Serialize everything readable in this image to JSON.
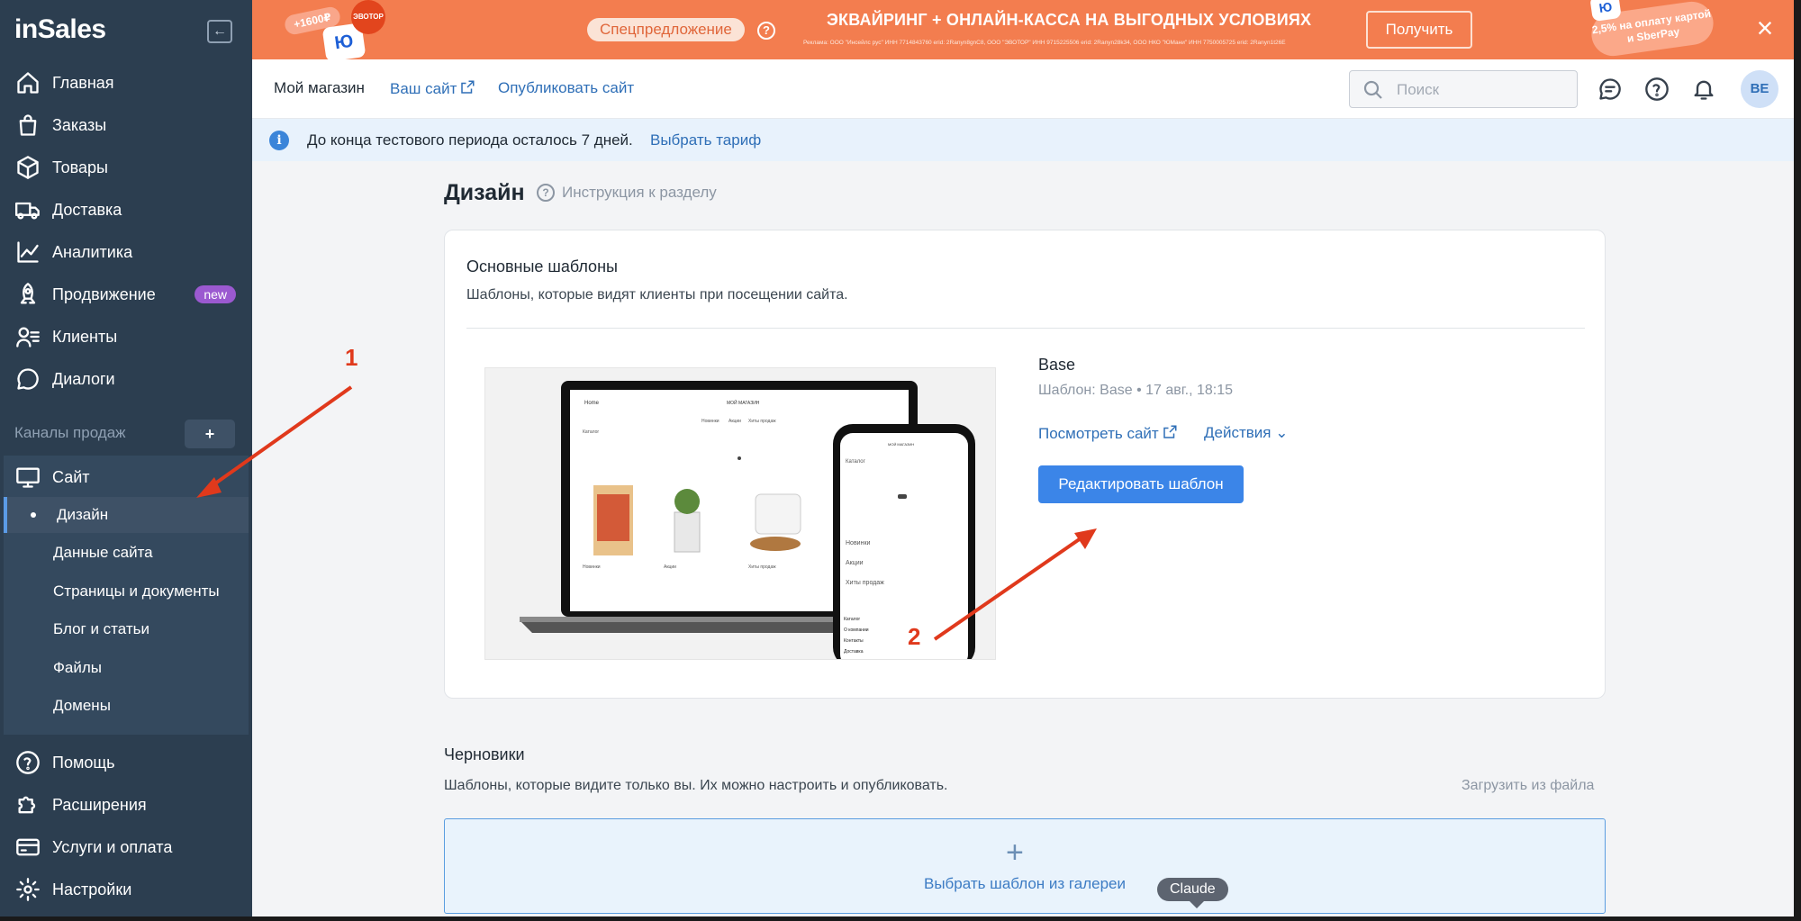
{
  "sidebar": {
    "logo": "inSales",
    "collapse_icon": "collapse-left-icon",
    "main_items": [
      {
        "label": "Главная",
        "icon": "home-icon"
      },
      {
        "label": "Заказы",
        "icon": "bag-icon"
      },
      {
        "label": "Товары",
        "icon": "box-icon"
      },
      {
        "label": "Доставка",
        "icon": "truck-icon"
      },
      {
        "label": "Аналитика",
        "icon": "chart-icon"
      },
      {
        "label": "Продвижение",
        "icon": "rocket-icon",
        "badge": "new"
      },
      {
        "label": "Клиенты",
        "icon": "clients-icon"
      },
      {
        "label": "Диалоги",
        "icon": "dialog-icon"
      }
    ],
    "channels_label": "Каналы продаж",
    "channels_add": "+",
    "site_item": {
      "label": "Сайт",
      "icon": "monitor-icon"
    },
    "site_sub_items": [
      "Дизайн",
      "Данные сайта",
      "Страницы и документы",
      "Блог и статьи",
      "Файлы",
      "Домены"
    ],
    "active_sub": "Дизайн",
    "bottom_items": [
      {
        "label": "Помощь",
        "icon": "help-icon"
      },
      {
        "label": "Расширения",
        "icon": "puzzle-icon"
      },
      {
        "label": "Услуги и оплата",
        "icon": "card-icon"
      },
      {
        "label": "Настройки",
        "icon": "gear-icon"
      }
    ]
  },
  "banner": {
    "special": "Спецпредложение",
    "title": "ЭКВАЙРИНГ + ОНЛАЙН-КАССА НА ВЫГОДНЫХ УСЛОВИЯХ",
    "legal": "Реклама: ООО \"Инсейлс рус\" ИНН 7714843760 erid: 2Ranyn8gnC8, ООО \"ЭВОТОР\" ИНН 9715225506 erid: 2Ranyn28k34, ООО НКО \"ЮМани\" ИНН 7750005725 erid: 2Ranyn1t26E",
    "cta": "Получить",
    "close": "×",
    "promo_left": "+1600₽",
    "promo_evo": "ЭВОТОР",
    "promo_yu": "Ю",
    "promo_right": "2,5% на оплату картой и SberPay",
    "background_color": "#f37d4f"
  },
  "topbar": {
    "store": "Мой магазин",
    "your_site": "Ваш сайт",
    "publish": "Опубликовать сайт",
    "search_placeholder": "Поиск",
    "avatar": "BE"
  },
  "infobar": {
    "text": "До конца тестового периода осталось 7 дней.",
    "link": "Выбрать тариф"
  },
  "main": {
    "title": "Дизайн",
    "help": "Инструкция к разделу",
    "templates": {
      "heading": "Основные шаблоны",
      "subheading": "Шаблоны, которые видят клиенты при посещении сайта.",
      "template_name": "Base",
      "template_meta": "Шаблон: Base • 17 авг., 18:15",
      "view_site": "Посмотреть сайт",
      "actions": "Действия",
      "edit": "Редактировать шаблон",
      "preview": {
        "laptop_brand": "Home",
        "laptop_store": "МОЙ МАГАЗИН",
        "laptop_nav": [
          "Новинки",
          "Акции",
          "Хиты продаж"
        ],
        "laptop_catalog": "Каталог",
        "laptop_products": [
          "Новинки",
          "Акции",
          "Хиты продаж"
        ],
        "phone_store": "МОЙ МАГАЗИН",
        "phone_catalog": "Каталог",
        "phone_items": [
          "Новинки",
          "Акции",
          "Хиты продаж"
        ],
        "phone_footer": [
          "Каталог",
          "О компании",
          "Контакты",
          "Доставка"
        ]
      }
    },
    "drafts": {
      "heading": "Черновики",
      "subheading": "Шаблоны, которые видите только вы. Их можно настроить и опубликовать.",
      "upload": "Загрузить из файла",
      "gallery": "Выбрать шаблон из галереи",
      "plus": "+"
    },
    "tooltip": "Claude"
  },
  "annotations": [
    "1",
    "2"
  ],
  "colors": {
    "sidebar_bg": "#2c3e50",
    "accent": "#3b85e8",
    "annotation": "#e0391c"
  }
}
